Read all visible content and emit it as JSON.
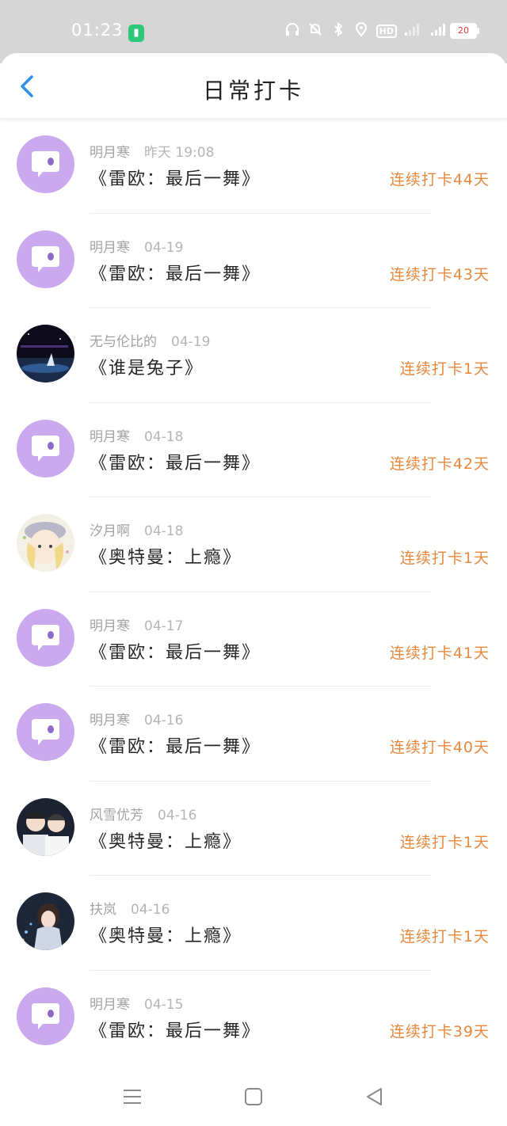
{
  "status_bar": {
    "time": "01:23",
    "battery_level": "20",
    "accent": "#2fc77a"
  },
  "header": {
    "title": "日常打卡",
    "back_icon": "chevron-left-icon",
    "accent": "#2f8fe8"
  },
  "entries": [
    {
      "user": "明月寒",
      "date": "昨天 19:08",
      "book": "《雷欧：最后一舞》",
      "streak": "连续打卡44天",
      "avatar": "chat-bubble"
    },
    {
      "user": "明月寒",
      "date": "04-19",
      "book": "《雷欧：最后一舞》",
      "streak": "连续打卡43天",
      "avatar": "chat-bubble"
    },
    {
      "user": "无与伦比的",
      "date": "04-19",
      "book": "《谁是兔子》",
      "streak": "连续打卡1天",
      "avatar": "night-scene"
    },
    {
      "user": "明月寒",
      "date": "04-18",
      "book": "《雷欧：最后一舞》",
      "streak": "连续打卡42天",
      "avatar": "chat-bubble"
    },
    {
      "user": "汐月啊",
      "date": "04-18",
      "book": "《奥特曼：上瘾》",
      "streak": "连续打卡1天",
      "avatar": "anime-girl"
    },
    {
      "user": "明月寒",
      "date": "04-17",
      "book": "《雷欧：最后一舞》",
      "streak": "连续打卡41天",
      "avatar": "chat-bubble"
    },
    {
      "user": "明月寒",
      "date": "04-16",
      "book": "《雷欧：最后一舞》",
      "streak": "连续打卡40天",
      "avatar": "chat-bubble"
    },
    {
      "user": "风雪优芳",
      "date": "04-16",
      "book": "《奥特曼：上瘾》",
      "streak": "连续打卡1天",
      "avatar": "two-boys"
    },
    {
      "user": "扶岚",
      "date": "04-16",
      "book": "《奥特曼：上瘾》",
      "streak": "连续打卡1天",
      "avatar": "anime-dark"
    },
    {
      "user": "明月寒",
      "date": "04-15",
      "book": "《雷欧：最后一舞》",
      "streak": "连续打卡39天",
      "avatar": "chat-bubble"
    }
  ],
  "nav": {
    "menu_icon": "menu-icon",
    "home_icon": "home-square-icon",
    "back_icon": "back-triangle-icon"
  }
}
